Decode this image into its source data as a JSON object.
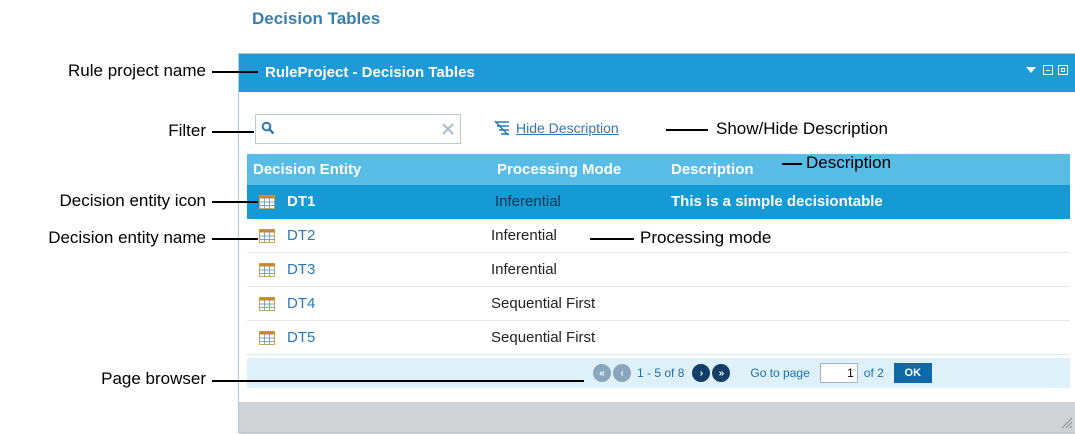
{
  "page_title": "Decision Tables",
  "window": {
    "title": "RuleProject - Decision Tables",
    "controls": [
      "chevron-down-icon",
      "minimize-icon",
      "maximize-icon"
    ]
  },
  "toolbar": {
    "filter_value": "",
    "hide_description_label": "Hide Description"
  },
  "columns": [
    "Decision Entity",
    "Processing Mode",
    "Description"
  ],
  "rows": [
    {
      "name": "DT1",
      "mode": "Inferential",
      "description": "This is a simple decisiontable",
      "selected": true
    },
    {
      "name": "DT2",
      "mode": "Inferential",
      "description": ""
    },
    {
      "name": "DT3",
      "mode": "Inferential",
      "description": ""
    },
    {
      "name": "DT4",
      "mode": "Sequential First",
      "description": ""
    },
    {
      "name": "DT5",
      "mode": "Sequential First",
      "description": ""
    }
  ],
  "pager": {
    "range": "1 - 5 of 8",
    "goto_label": "Go to page",
    "page": "1",
    "of_label": "of 2",
    "ok_label": "OK"
  },
  "annotations": {
    "rule_project_name": "Rule project name",
    "filter": "Filter",
    "show_hide_description": "Show/Hide Description",
    "description": "Description",
    "decision_entity_icon": "Decision entity icon",
    "decision_entity_name": "Decision entity name",
    "processing_mode": "Processing mode",
    "page_browser": "Page browser"
  },
  "colors": {
    "titlebar": "#1e9ad6",
    "header": "#58bce6",
    "selected_row": "#159ad6",
    "link": "#2c78b4"
  }
}
